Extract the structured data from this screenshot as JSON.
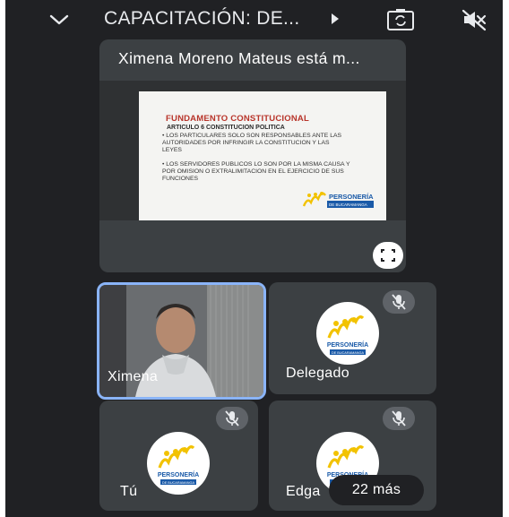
{
  "topbar": {
    "title": "CAPACITACIÓN: DE...",
    "collapse_icon": "chevron-down-icon",
    "play_icon": "play-arrow-icon",
    "camera_icon": "switch-camera-icon",
    "audio_icon": "speaker-off-icon"
  },
  "presentation": {
    "presenter_label": "Ximena Moreno Mateus está m...",
    "slide": {
      "title": "FUNDAMENTO CONSTITUCIONAL",
      "subtitle": "ARTICULO 6 CONSTITUCION POLITICA",
      "bullet_1": "• LOS PARTICULARES SOLO SON RESPONSABLES ANTE LAS AUTORIDADES POR INFRINGIR LA CONSTITUCION Y LAS LEYES",
      "bullet_2": "• LOS SERVIDORES PUBLICOS LO SON POR LA MISMA CAUSA Y POR OMISION O EXTRALIMITACION EN EL EJERCICIO DE SUS FUNCIONES",
      "logo_text": "PERSONERÍA",
      "logo_subtext": "DE BUCARAMANGA"
    },
    "fullscreen_icon": "fullscreen-icon"
  },
  "participants": [
    {
      "name": "Ximena",
      "muted": false,
      "video": true
    },
    {
      "name": "Delegado",
      "muted": true,
      "video": false
    },
    {
      "name": "Tú",
      "muted": true,
      "video": false
    },
    {
      "name": "Edga",
      "muted": true,
      "video": false
    }
  ],
  "avatar_logo": {
    "line1": "PERSONERÍA",
    "line2": "DE BUCARAMANGA"
  },
  "overflow": {
    "label": "22 más"
  },
  "colors": {
    "background": "#202124",
    "tile": "#3c4043",
    "active_border": "#8ab4f8",
    "logo_blue": "#1a5aa8",
    "logo_yellow": "#f2c200"
  }
}
